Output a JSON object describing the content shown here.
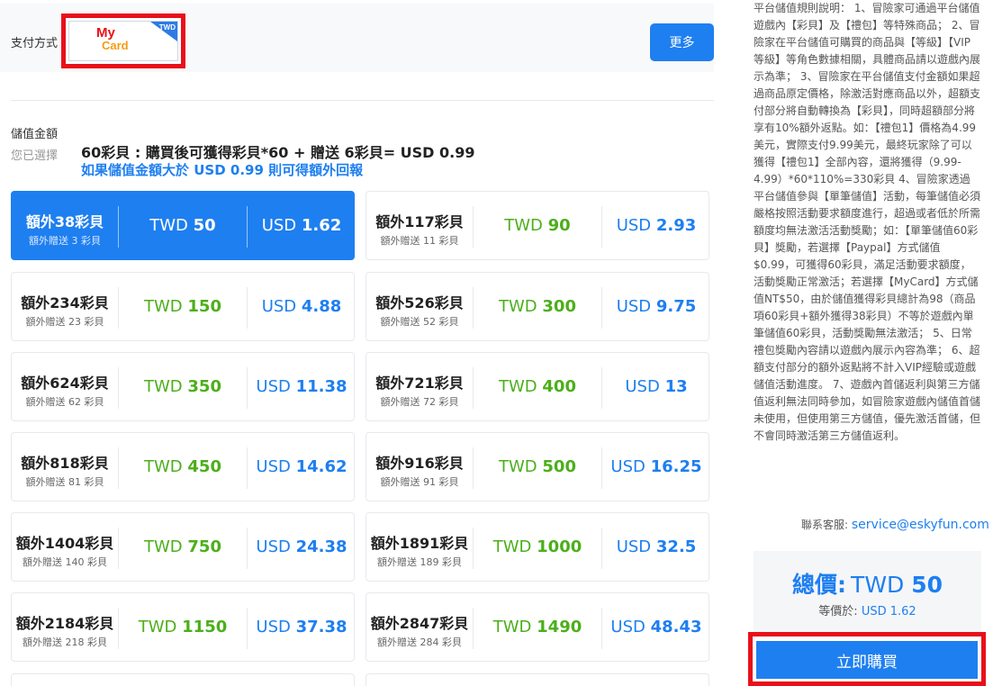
{
  "payment": {
    "label": "支付方式",
    "method_logo_line1": "My",
    "method_logo_line2": "Card",
    "method_currency": "TWD",
    "more_button": "更多"
  },
  "amount": {
    "label": "儲值金額",
    "selected_label": "您已選擇",
    "summary": "60彩貝 : 購買後可獲得彩貝*60 + 贈送 6彩貝= USD 0.99",
    "bonus_hint": "如果儲值金額大於 USD 0.99 則可得額外回報"
  },
  "packages": [
    {
      "main": "額外38彩貝",
      "sub": "額外贈送 3 彩貝",
      "twd_cur": "TWD",
      "twd": "50",
      "usd_cur": "USD",
      "usd": "1.62",
      "selected": true
    },
    {
      "main": "額外117彩貝",
      "sub": "額外贈送 11 彩貝",
      "twd_cur": "TWD",
      "twd": "90",
      "usd_cur": "USD",
      "usd": "2.93",
      "selected": false
    },
    {
      "main": "額外234彩貝",
      "sub": "額外贈送 23 彩貝",
      "twd_cur": "TWD",
      "twd": "150",
      "usd_cur": "USD",
      "usd": "4.88",
      "selected": false
    },
    {
      "main": "額外526彩貝",
      "sub": "額外贈送 52 彩貝",
      "twd_cur": "TWD",
      "twd": "300",
      "usd_cur": "USD",
      "usd": "9.75",
      "selected": false
    },
    {
      "main": "額外624彩貝",
      "sub": "額外贈送 62 彩貝",
      "twd_cur": "TWD",
      "twd": "350",
      "usd_cur": "USD",
      "usd": "11.38",
      "selected": false
    },
    {
      "main": "額外721彩貝",
      "sub": "額外贈送 72 彩貝",
      "twd_cur": "TWD",
      "twd": "400",
      "usd_cur": "USD",
      "usd": "13",
      "selected": false
    },
    {
      "main": "額外818彩貝",
      "sub": "額外贈送 81 彩貝",
      "twd_cur": "TWD",
      "twd": "450",
      "usd_cur": "USD",
      "usd": "14.62",
      "selected": false
    },
    {
      "main": "額外916彩貝",
      "sub": "額外贈送 91 彩貝",
      "twd_cur": "TWD",
      "twd": "500",
      "usd_cur": "USD",
      "usd": "16.25",
      "selected": false
    },
    {
      "main": "額外1404彩貝",
      "sub": "額外贈送 140 彩貝",
      "twd_cur": "TWD",
      "twd": "750",
      "usd_cur": "USD",
      "usd": "24.38",
      "selected": false
    },
    {
      "main": "額外1891彩貝",
      "sub": "額外贈送 189 彩貝",
      "twd_cur": "TWD",
      "twd": "1000",
      "usd_cur": "USD",
      "usd": "32.5",
      "selected": false
    },
    {
      "main": "額外2184彩貝",
      "sub": "額外贈送 218 彩貝",
      "twd_cur": "TWD",
      "twd": "1150",
      "usd_cur": "USD",
      "usd": "37.38",
      "selected": false
    },
    {
      "main": "額外2847彩貝",
      "sub": "額外贈送 284 彩貝",
      "twd_cur": "TWD",
      "twd": "1490",
      "usd_cur": "USD",
      "usd": "48.43",
      "selected": false
    }
  ],
  "rules": {
    "text": "平台儲值規則說明： 1、冒險家可通過平台儲值遊戲內【彩貝】及【禮包】等特殊商品； 2、冒險家在平台儲值可購買的商品與【等級】【VIP等級】等角色數據相關，具體商品請以遊戲內展示為準； 3、冒險家在平台儲值支付金額如果超過商品原定價格，除激活對應商品以外，超額支付部分將自動轉換為【彩貝】，同時超額部分將享有10%額外返點。如：【禮包1】價格為4.99美元，實際支付9.99美元，最終玩家除了可以獲得【禮包1】全部內容，還將獲得（9.99-4.99）*60*110%=330彩貝 4、冒險家透過平台儲值參與【單筆儲值】活動，每筆儲值必須嚴格按照活動要求額度進行，超過或者低於所需額度均無法激活活動獎勵；如：【單筆儲值60彩貝】獎勵，若選擇【Paypal】方式儲值$0.99，可獲得60彩貝，滿足活動要求額度，活動獎勵正常激活；若選擇【MyCard】方式儲值NT$50，由於儲值獲得彩貝總計為98（商品項60彩貝+額外獲得38彩貝）不等於遊戲內單筆儲值60彩貝，活動獎勵無法激活； 5、日常禮包獎勵內容請以遊戲內展示內容為準； 6、超額支付部分的額外返點將不計入VIP經驗或遊戲儲值活動進度。 7、遊戲內首儲返利與第三方儲值返利無法同時參加，如冒險家遊戲內儲值首儲未使用，但使用第三方儲值，優先激活首儲，但不會同時激活第三方儲值返利。",
    "contact_label": "聯系客服:",
    "contact_email": "service@eskyfun.com"
  },
  "total": {
    "label": "總價:",
    "currency": "TWD",
    "value": "50",
    "equiv_label": "等價於:",
    "equiv_value": "USD 1.62"
  },
  "buy": {
    "label": "立即購買"
  },
  "colors": {
    "accent": "#1e7ff0",
    "twd_green": "#4caf1a",
    "highlight_red": "#e8101a"
  }
}
